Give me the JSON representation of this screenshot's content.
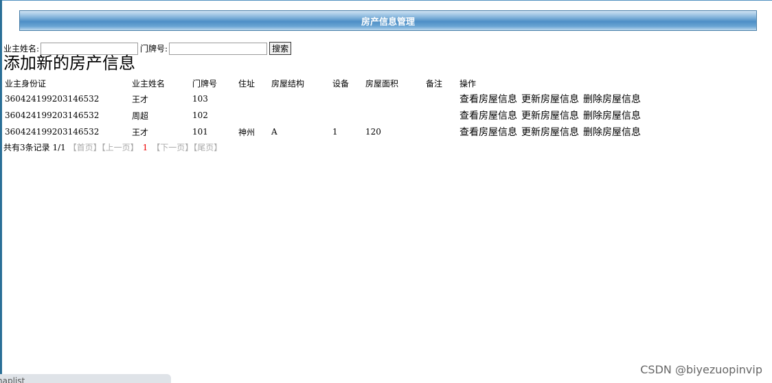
{
  "header": {
    "title": "房产信息管理"
  },
  "search": {
    "owner_name_label": "业主姓名:",
    "owner_name_value": "",
    "door_number_label": "门牌号:",
    "door_number_value": "",
    "search_button": "搜索"
  },
  "add_link": "添加新的房产信息",
  "table": {
    "columns": [
      "业主身份证",
      "业主姓名",
      "门牌号",
      "住址",
      "房屋结构",
      "设备",
      "房屋面积",
      "备注",
      "操作"
    ],
    "rows": [
      {
        "id_card": "360424199203146532",
        "owner": "王才",
        "door": "103",
        "address": "",
        "structure": "",
        "equipment": "",
        "area": "",
        "remark": ""
      },
      {
        "id_card": "360424199203146532",
        "owner": "周超",
        "door": "102",
        "address": "",
        "structure": "",
        "equipment": "",
        "area": "",
        "remark": ""
      },
      {
        "id_card": "360424199203146532",
        "owner": "王才",
        "door": "101",
        "address": "神州",
        "structure": "A",
        "equipment": "1",
        "area": "120",
        "remark": ""
      }
    ],
    "actions": {
      "view": "查看房屋信息",
      "update": "更新房屋信息",
      "delete": "删除房屋信息"
    }
  },
  "pager": {
    "total": "共有3条记录",
    "page": "1/1",
    "first": "【首页】",
    "prev": "【上一页】",
    "current": "1",
    "next": "【下一页】",
    "last": "【尾页】"
  },
  "watermark": "CSDN @biyezuopinvip",
  "bottom_tab": "haplist"
}
